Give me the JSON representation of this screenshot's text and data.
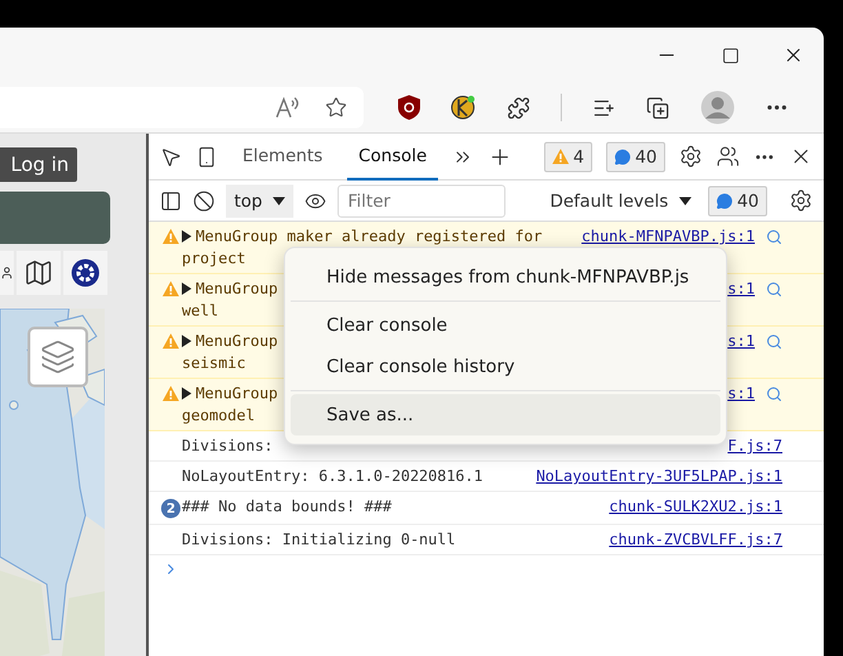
{
  "page": {
    "login_button": "Log in"
  },
  "devtools": {
    "tabs": [
      {
        "label": "Elements",
        "selected": false
      },
      {
        "label": "Console",
        "selected": true
      }
    ],
    "warnings_badge": "4",
    "messages_badge": "40",
    "context_selector": "top",
    "filter": {
      "placeholder": "Filter"
    },
    "levels_dropdown": "Default levels",
    "messages_count": "40",
    "messages": [
      {
        "kind": "warning",
        "expanded": false,
        "lines": [
          "MenuGroup maker already registered for",
          "project"
        ],
        "source": "chunk-MFNPAVBP.js:1"
      },
      {
        "kind": "warning",
        "expanded": false,
        "lines": [
          "MenuGroup",
          "well"
        ],
        "source": "s:1"
      },
      {
        "kind": "warning",
        "expanded": false,
        "lines": [
          "MenuGroup",
          "seismic"
        ],
        "source": "s:1"
      },
      {
        "kind": "warning",
        "expanded": false,
        "lines": [
          "MenuGroup",
          "geomodel"
        ],
        "source": "s:1"
      },
      {
        "kind": "log",
        "lines": [
          "Divisions:"
        ],
        "source": "F.js:7"
      },
      {
        "kind": "log",
        "lines": [
          "NoLayoutEntry: 6.3.1.0-20220816.1"
        ],
        "source": "NoLayoutEntry-3UF5LPAP.js:1"
      },
      {
        "kind": "log",
        "repeat_count": "2",
        "lines": [
          "### No data bounds! ###"
        ],
        "source": "chunk-SULK2XU2.js:1"
      },
      {
        "kind": "log",
        "lines": [
          "Divisions: Initializing 0-null"
        ],
        "source": "chunk-ZVCBVLFF.js:7"
      }
    ],
    "context_menu": {
      "groups": [
        {
          "items": [
            {
              "label": "Hide messages from chunk-MFNPAVBP.js",
              "selected": false
            }
          ]
        },
        {
          "items": [
            {
              "label": "Clear console",
              "selected": false
            },
            {
              "label": "Clear console history",
              "selected": false
            }
          ]
        },
        {
          "items": [
            {
              "label": "Save as...",
              "selected": true
            }
          ]
        }
      ]
    }
  }
}
